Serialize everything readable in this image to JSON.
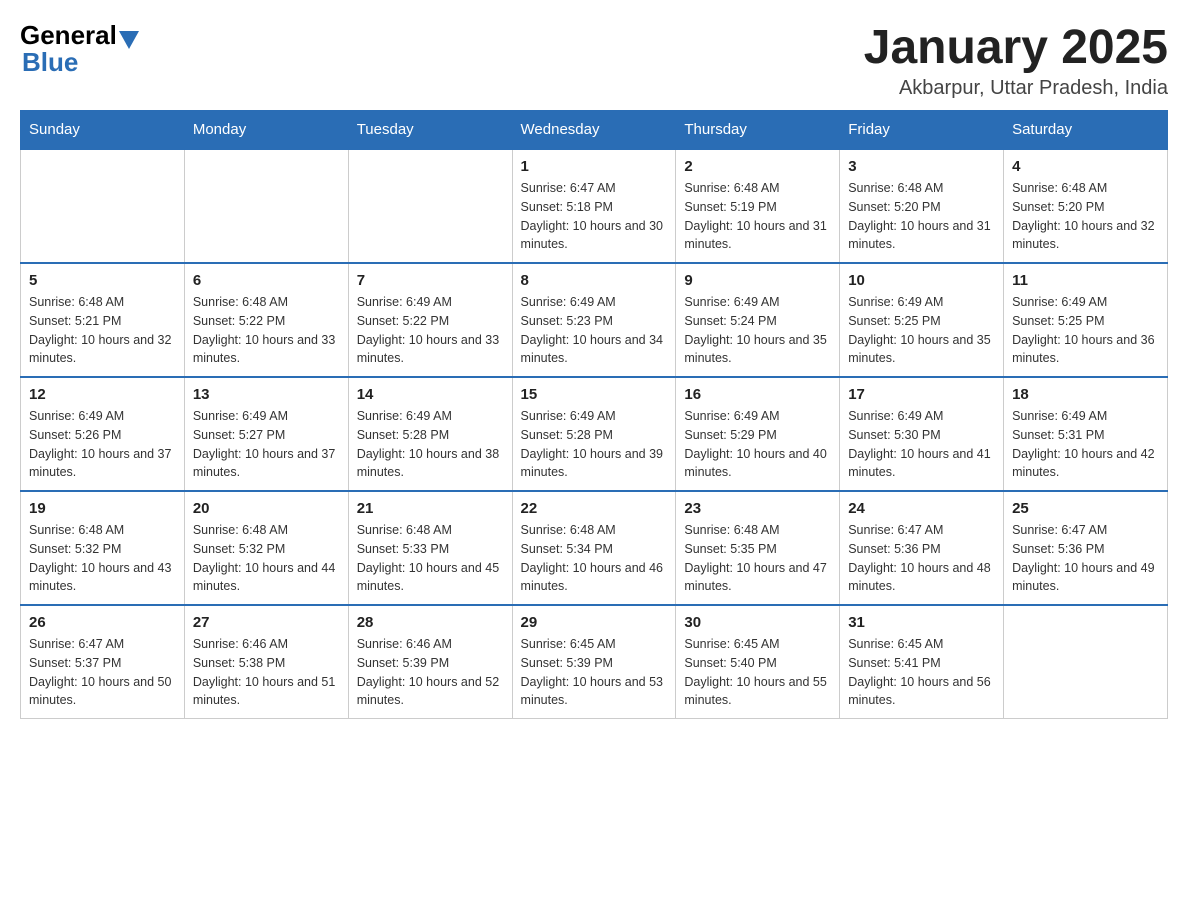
{
  "header": {
    "logo_general": "General",
    "logo_blue": "Blue",
    "month_title": "January 2025",
    "location": "Akbarpur, Uttar Pradesh, India"
  },
  "weekdays": [
    "Sunday",
    "Monday",
    "Tuesday",
    "Wednesday",
    "Thursday",
    "Friday",
    "Saturday"
  ],
  "weeks": [
    [
      {
        "day": "",
        "info": ""
      },
      {
        "day": "",
        "info": ""
      },
      {
        "day": "",
        "info": ""
      },
      {
        "day": "1",
        "info": "Sunrise: 6:47 AM\nSunset: 5:18 PM\nDaylight: 10 hours and 30 minutes."
      },
      {
        "day": "2",
        "info": "Sunrise: 6:48 AM\nSunset: 5:19 PM\nDaylight: 10 hours and 31 minutes."
      },
      {
        "day": "3",
        "info": "Sunrise: 6:48 AM\nSunset: 5:20 PM\nDaylight: 10 hours and 31 minutes."
      },
      {
        "day": "4",
        "info": "Sunrise: 6:48 AM\nSunset: 5:20 PM\nDaylight: 10 hours and 32 minutes."
      }
    ],
    [
      {
        "day": "5",
        "info": "Sunrise: 6:48 AM\nSunset: 5:21 PM\nDaylight: 10 hours and 32 minutes."
      },
      {
        "day": "6",
        "info": "Sunrise: 6:48 AM\nSunset: 5:22 PM\nDaylight: 10 hours and 33 minutes."
      },
      {
        "day": "7",
        "info": "Sunrise: 6:49 AM\nSunset: 5:22 PM\nDaylight: 10 hours and 33 minutes."
      },
      {
        "day": "8",
        "info": "Sunrise: 6:49 AM\nSunset: 5:23 PM\nDaylight: 10 hours and 34 minutes."
      },
      {
        "day": "9",
        "info": "Sunrise: 6:49 AM\nSunset: 5:24 PM\nDaylight: 10 hours and 35 minutes."
      },
      {
        "day": "10",
        "info": "Sunrise: 6:49 AM\nSunset: 5:25 PM\nDaylight: 10 hours and 35 minutes."
      },
      {
        "day": "11",
        "info": "Sunrise: 6:49 AM\nSunset: 5:25 PM\nDaylight: 10 hours and 36 minutes."
      }
    ],
    [
      {
        "day": "12",
        "info": "Sunrise: 6:49 AM\nSunset: 5:26 PM\nDaylight: 10 hours and 37 minutes."
      },
      {
        "day": "13",
        "info": "Sunrise: 6:49 AM\nSunset: 5:27 PM\nDaylight: 10 hours and 37 minutes."
      },
      {
        "day": "14",
        "info": "Sunrise: 6:49 AM\nSunset: 5:28 PM\nDaylight: 10 hours and 38 minutes."
      },
      {
        "day": "15",
        "info": "Sunrise: 6:49 AM\nSunset: 5:28 PM\nDaylight: 10 hours and 39 minutes."
      },
      {
        "day": "16",
        "info": "Sunrise: 6:49 AM\nSunset: 5:29 PM\nDaylight: 10 hours and 40 minutes."
      },
      {
        "day": "17",
        "info": "Sunrise: 6:49 AM\nSunset: 5:30 PM\nDaylight: 10 hours and 41 minutes."
      },
      {
        "day": "18",
        "info": "Sunrise: 6:49 AM\nSunset: 5:31 PM\nDaylight: 10 hours and 42 minutes."
      }
    ],
    [
      {
        "day": "19",
        "info": "Sunrise: 6:48 AM\nSunset: 5:32 PM\nDaylight: 10 hours and 43 minutes."
      },
      {
        "day": "20",
        "info": "Sunrise: 6:48 AM\nSunset: 5:32 PM\nDaylight: 10 hours and 44 minutes."
      },
      {
        "day": "21",
        "info": "Sunrise: 6:48 AM\nSunset: 5:33 PM\nDaylight: 10 hours and 45 minutes."
      },
      {
        "day": "22",
        "info": "Sunrise: 6:48 AM\nSunset: 5:34 PM\nDaylight: 10 hours and 46 minutes."
      },
      {
        "day": "23",
        "info": "Sunrise: 6:48 AM\nSunset: 5:35 PM\nDaylight: 10 hours and 47 minutes."
      },
      {
        "day": "24",
        "info": "Sunrise: 6:47 AM\nSunset: 5:36 PM\nDaylight: 10 hours and 48 minutes."
      },
      {
        "day": "25",
        "info": "Sunrise: 6:47 AM\nSunset: 5:36 PM\nDaylight: 10 hours and 49 minutes."
      }
    ],
    [
      {
        "day": "26",
        "info": "Sunrise: 6:47 AM\nSunset: 5:37 PM\nDaylight: 10 hours and 50 minutes."
      },
      {
        "day": "27",
        "info": "Sunrise: 6:46 AM\nSunset: 5:38 PM\nDaylight: 10 hours and 51 minutes."
      },
      {
        "day": "28",
        "info": "Sunrise: 6:46 AM\nSunset: 5:39 PM\nDaylight: 10 hours and 52 minutes."
      },
      {
        "day": "29",
        "info": "Sunrise: 6:45 AM\nSunset: 5:39 PM\nDaylight: 10 hours and 53 minutes."
      },
      {
        "day": "30",
        "info": "Sunrise: 6:45 AM\nSunset: 5:40 PM\nDaylight: 10 hours and 55 minutes."
      },
      {
        "day": "31",
        "info": "Sunrise: 6:45 AM\nSunset: 5:41 PM\nDaylight: 10 hours and 56 minutes."
      },
      {
        "day": "",
        "info": ""
      }
    ]
  ]
}
